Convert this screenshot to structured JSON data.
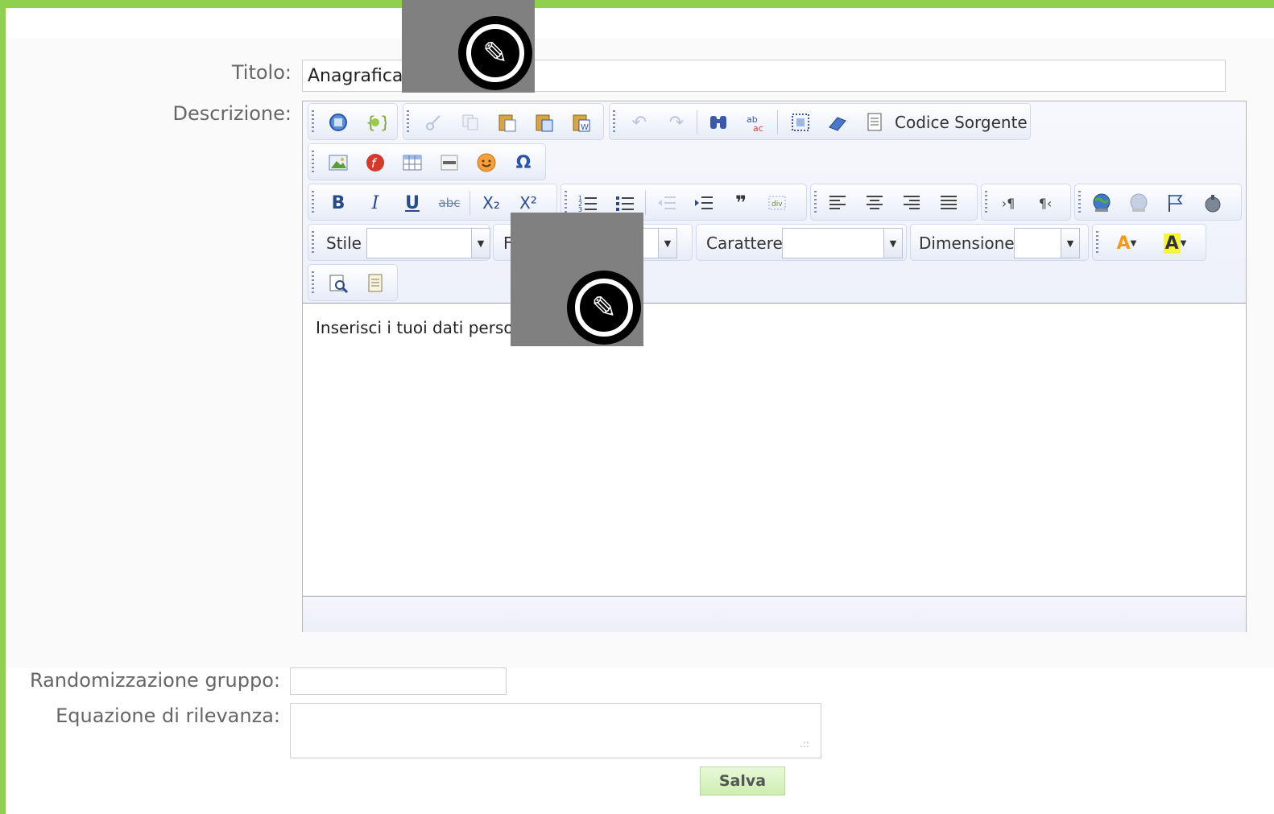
{
  "form": {
    "title_label": "Titolo:",
    "title_value": "Anagrafica",
    "description_label": "Descrizione:",
    "group_label": "Randomizzazione gruppo:",
    "group_value": "",
    "relevance_label": "Equazione di rilevanza:",
    "relevance_value": "",
    "save_label": "Salva"
  },
  "editor": {
    "source_label": "Codice Sorgente",
    "style_label": "Stile",
    "format_label": "F",
    "font_label": "Carattere",
    "size_label": "Dimensione",
    "content": "Inserisci i tuoi dati person"
  },
  "icons": {
    "undo": "↶",
    "redo": "↷",
    "omega": "Ω",
    "bold": "B",
    "italic": "I",
    "underline": "U",
    "strike": "abc",
    "subscript": "X₂",
    "superscript": "X²",
    "pilcrow_ltr": "›¶",
    "pilcrow_rtl": "¶‹",
    "font_color": "A",
    "bg_color": "A",
    "edit": "✎"
  },
  "colors": {
    "frame_green": "#8fd14f",
    "save_bg": "#cdeeb0"
  }
}
